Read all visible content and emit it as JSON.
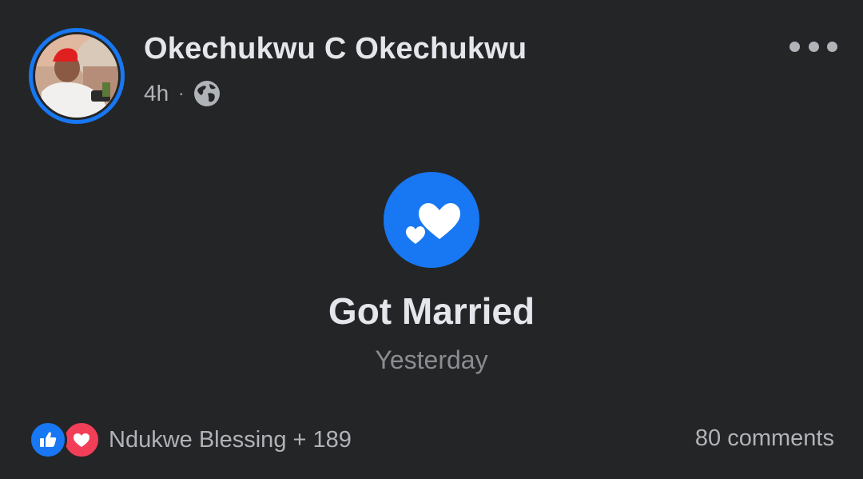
{
  "post": {
    "author_name": "Okechukwu C Okechukwu",
    "time": "4h",
    "separator": "·",
    "privacy_icon": "globe-icon",
    "more_icon": "more-options-icon"
  },
  "life_event": {
    "icon": "hearts-icon",
    "title": "Got Married",
    "date": "Yesterday"
  },
  "footer": {
    "reactions": [
      "like-icon",
      "love-icon"
    ],
    "reaction_summary": "Ndukwe Blessing + 189",
    "comments": "80 comments"
  },
  "colors": {
    "background": "#242526",
    "accent": "#1877f2",
    "love": "#f33e58",
    "primary_text": "#e4e6eb",
    "secondary_text": "#b0b3b8"
  }
}
